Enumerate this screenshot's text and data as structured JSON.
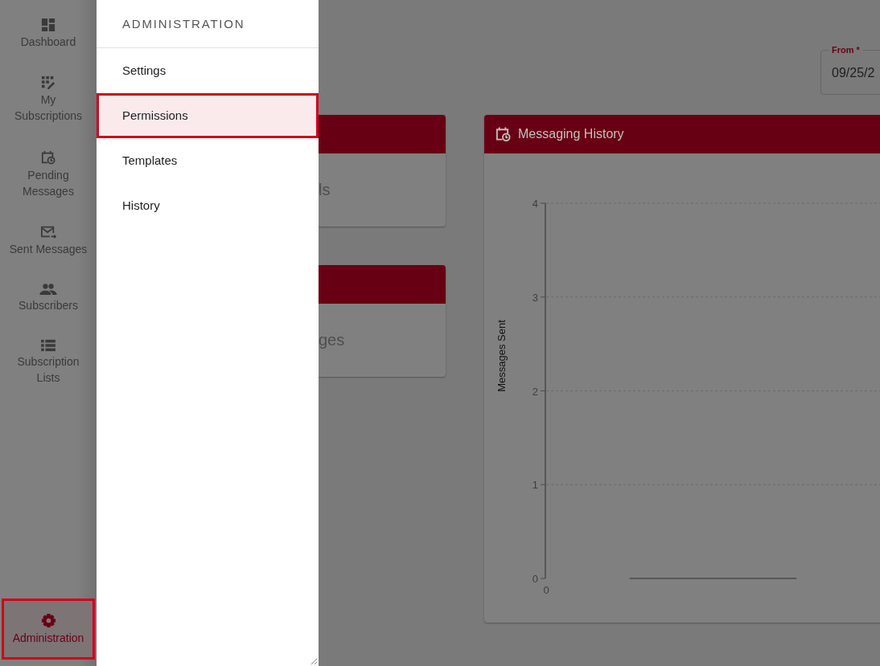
{
  "sidebar": {
    "items": [
      {
        "label": "Dashboard",
        "selected": false
      },
      {
        "label": "My Subscriptions",
        "selected": false
      },
      {
        "label": "Pending Messages",
        "selected": false
      },
      {
        "label": "Sent Messages",
        "selected": false
      },
      {
        "label": "Subscribers",
        "selected": false
      },
      {
        "label": "Subscription Lists",
        "selected": false
      },
      {
        "label": "Administration",
        "selected": true
      }
    ]
  },
  "drawer": {
    "title": "ADMINISTRATION",
    "items": [
      {
        "label": "Settings",
        "selected": false
      },
      {
        "label": "Permissions",
        "selected": true
      },
      {
        "label": "Templates",
        "selected": false
      },
      {
        "label": "History",
        "selected": false
      }
    ]
  },
  "date_filter": {
    "label": "From *",
    "value": "09/25/2"
  },
  "cards": [
    {
      "text": "ls"
    },
    {
      "text": "ges"
    }
  ],
  "history_card": {
    "title": "Messaging History",
    "chart_data": {
      "type": "line",
      "grid": true,
      "categories": [
        null,
        null
      ],
      "series": [
        {
          "color": "#4a4a4a",
          "values": [
            0,
            0
          ]
        }
      ],
      "ylabel": "Messages Sent",
      "ylim": [
        0,
        4
      ],
      "yticks": [
        {
          "value": 0,
          "label": "0"
        },
        {
          "value": 1,
          "label": "1"
        },
        {
          "value": 2,
          "label": "2"
        },
        {
          "value": 3,
          "label": "3"
        },
        {
          "value": 4,
          "label": "4"
        }
      ]
    },
    "x_origin_label": "0"
  }
}
